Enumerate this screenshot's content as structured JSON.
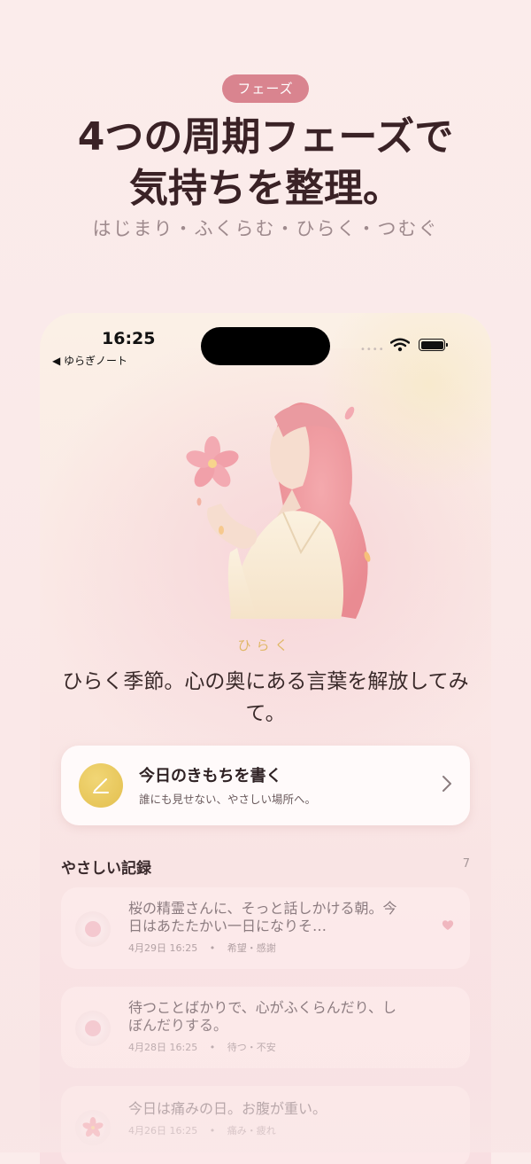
{
  "promo": {
    "badge": "フェーズ",
    "headline_line1": "4つの周期フェーズで",
    "headline_line2": "気持ちを整理。",
    "subline": "はじまり・ふくらむ・ひらく・つむぐ"
  },
  "status_bar": {
    "time": "16:25",
    "back_label": "◀ ゆらぎノート"
  },
  "phase": {
    "label": "ひらく",
    "message": "ひらく季節。心の奥にある言葉を解放してみて。"
  },
  "write_card": {
    "title": "今日のきもちを書く",
    "subtitle": "誰にも見せない、やさしい場所へ。"
  },
  "records": {
    "title": "やさしい記録",
    "count": "7",
    "entries": [
      {
        "text": "桜の精霊さんに、そっと話しかける朝。今日はあたたかい一日になりそ…",
        "date": "4月29日 16:25",
        "tags": "希望・感謝",
        "icon": "dot-icon",
        "favorite": true
      },
      {
        "text": "待つことばかりで、心がふくらんだり、しぼんだりする。",
        "date": "4月28日 16:25",
        "tags": "待つ・不安",
        "icon": "dot-icon",
        "favorite": false
      },
      {
        "text": "今日は痛みの日。お腹が重い。",
        "date": "4月26日 16:25",
        "tags": "痛み・疲れ",
        "icon": "sakura-icon",
        "favorite": false
      }
    ]
  },
  "colors": {
    "badge": "#d9848f",
    "accent_gold": "#e3bf4e",
    "heart": "#f0b7bf"
  }
}
